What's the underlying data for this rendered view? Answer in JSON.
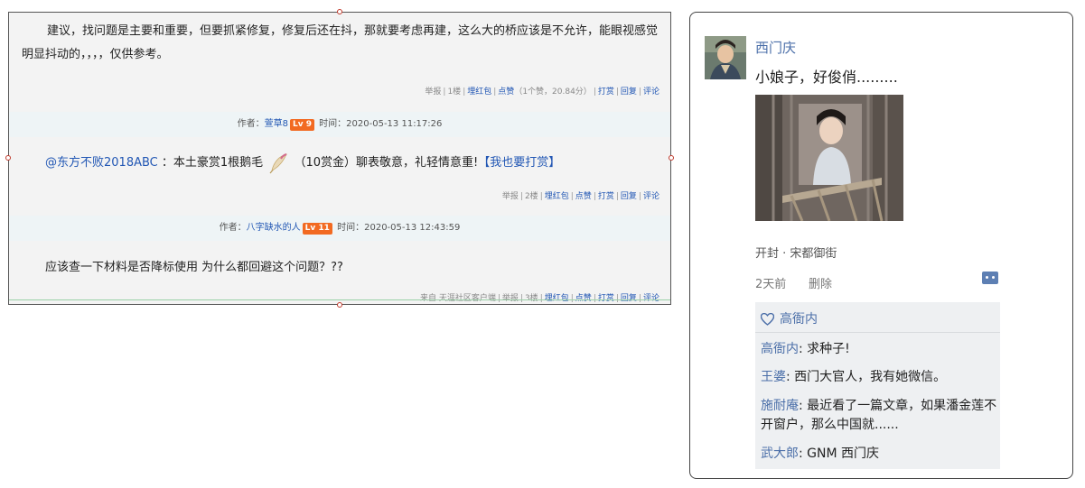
{
  "forum": {
    "post1": {
      "text": "建议，找问题是主要和重要，但要抓紧修复，修复后还在抖，那就要考虑再建，这么大的桥应该是不允许，能眼视感觉明显抖动的，，，，仅供参考。",
      "footer": {
        "report": "举报",
        "floor": "1楼",
        "red_packet": "埋红包",
        "like": "点赞",
        "like_detail": "（1个赞，20.84分）",
        "tip": "打赏",
        "reply": "回复",
        "comment": "评论"
      }
    },
    "author2": {
      "prefix": "作者：",
      "name": "萱草8",
      "level": "Lv 9",
      "time": "时间：2020-05-13 11:17:26"
    },
    "post2": {
      "mention": "@东方不败2018ABC",
      "text_a": "：本土豪赏1根鹅毛",
      "text_b": "（10赏金）聊表敬意，礼轻情意重!",
      "link": "【我也要打赏】",
      "footer": {
        "report": "举报",
        "floor": "2楼",
        "red_packet": "埋红包",
        "like": "点赞",
        "tip": "打赏",
        "reply": "回复",
        "comment": "评论"
      }
    },
    "author3": {
      "prefix": "作者：",
      "name": "八字缺水的人",
      "level": "Lv 11",
      "time": "时间：2020-05-13 12:43:59"
    },
    "post3": {
      "text": "应该查一下材料是否降标使用 为什么都回避这个问题？??",
      "footer": {
        "source": "来自 天涯社区客户端",
        "report": "举报",
        "floor": "3楼",
        "red_packet": "埋红包",
        "like": "点赞",
        "tip": "打赏",
        "reply": "回复",
        "comment": "评论"
      }
    }
  },
  "social": {
    "user_name": "西门庆",
    "post_text": "小娘子，好俊俏.........",
    "location": "开封 · 宋都御街",
    "time": "2天前",
    "delete": "删除",
    "likes": {
      "icon": "heart-icon",
      "names": "高衙内"
    },
    "comments": [
      {
        "name": "高衙内",
        "text": ": 求种子!"
      },
      {
        "name": "王婆",
        "text": ": 西门大官人，我有她微信。"
      },
      {
        "name": "施耐庵",
        "text": ": 最近看了一篇文章，如果潘金莲不开窗户，那么中国就......"
      },
      {
        "name": "武大郎",
        "text": ": GNM 西门庆"
      }
    ],
    "accent": "#4a6ea8"
  }
}
